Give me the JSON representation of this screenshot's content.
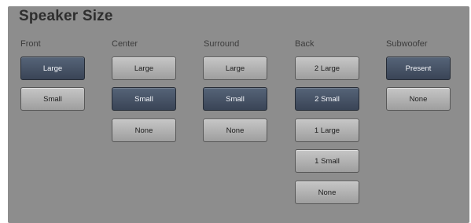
{
  "title": "Speaker Size",
  "columns": {
    "front": {
      "header": "Front",
      "buttons": [
        "Large",
        "Small"
      ],
      "selected": "Large"
    },
    "center": {
      "header": "Center",
      "buttons": [
        "Large",
        "Small",
        "None"
      ],
      "selected": "Small"
    },
    "surround": {
      "header": "Surround",
      "buttons": [
        "Large",
        "Small",
        "None"
      ],
      "selected": "Small"
    },
    "back": {
      "header": "Back",
      "buttons": [
        "2 Large",
        "2 Small",
        "1 Large",
        "1 Small",
        "None"
      ],
      "selected": "2 Small"
    },
    "subwoofer": {
      "header": "Subwoofer",
      "buttons": [
        "Present",
        "None"
      ],
      "selected": "Present"
    }
  },
  "colors": {
    "panel_background": "#8d8d8d",
    "button_selected": "#3f4a5c",
    "button_unselected": "#b5b5b5"
  }
}
